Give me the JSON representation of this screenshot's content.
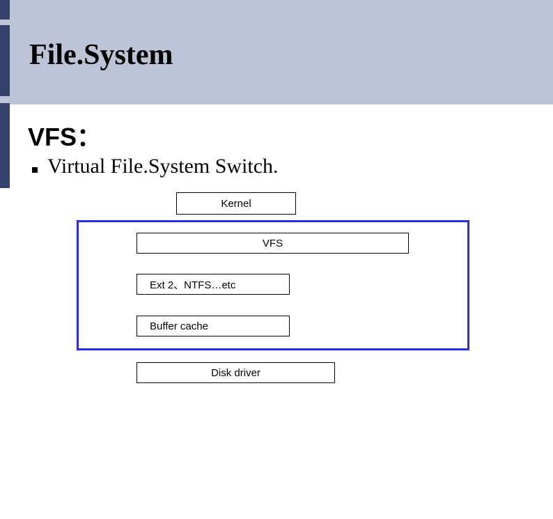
{
  "title": "File.System",
  "subtitle": "VFS：",
  "bullet_text": "Virtual File.System Switch.",
  "diagram": {
    "kernel": "Kernel",
    "vfs": "VFS",
    "ext": "Ext 2、NTFS…etc",
    "buffer": "Buffer cache",
    "disk": "Disk driver"
  }
}
